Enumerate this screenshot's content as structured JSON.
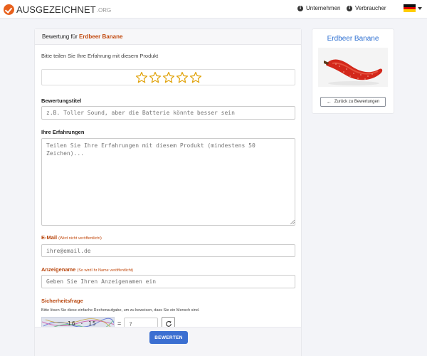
{
  "brand": {
    "name": "AUSGEZEICHNET",
    "tld": ".ORG",
    "accent": "#e8601c"
  },
  "nav": {
    "company_label": "Unternehmen",
    "consumer_label": "Verbraucher"
  },
  "review": {
    "header_prefix": "Bewertung für",
    "product_name": "Erdbeer Banane",
    "intro": "Bitte teilen Sie Ihre Erfahrung mit diesem Produkt",
    "rating": 0,
    "rating_max": 5,
    "title_label": "Bewertungstitel",
    "title_placeholder": "z.B. Toller Sound, aber die Batterie könnte besser sein",
    "experience_label": "Ihre Erfahrungen",
    "experience_placeholder": "Teilen Sie Ihre Erfahrungen mit diesem Produkt (mindestens 50 Zeichen)...",
    "email_label": "E-Mail",
    "email_hint": "(Wird nicht veröffentlicht)",
    "email_placeholder": "ihre@email.de",
    "display_name_label": "Anzeigename",
    "display_name_hint": "(So wird Ihr Name veröffentlicht)",
    "display_name_placeholder": "Geben Sie Ihren Anzeigenamen ein",
    "security_label": "Sicherheitsfrage",
    "security_desc": "Bitte lösen Sie diese einfache Rechenaufgabe, um zu beweisen, dass Sie ein Mensch sind.",
    "captcha_text": "16 · 15",
    "equals": "=",
    "answer_placeholder": "?",
    "submit_label": "BEWERTEN"
  },
  "sidebar": {
    "product_title": "Erdbeer Banane",
    "back_label": "Zurück zu Bewertungen"
  }
}
